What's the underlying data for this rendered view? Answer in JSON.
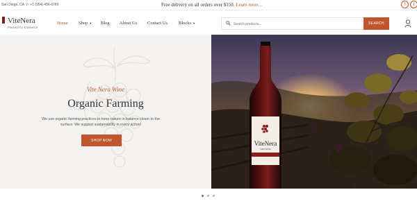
{
  "topbar": {
    "location": "San Diego, CA",
    "phone": "+1 (954) 456-6789",
    "promo_text": "Free delivery on all orders over $150.",
    "promo_link": "Learn more...",
    "social": [
      "facebook-icon",
      "twitter-icon"
    ]
  },
  "brand": {
    "name": "ViteNera",
    "tagline": "Passion for Existence",
    "accent_color": "#c0572c",
    "wine_color": "#7a1a1a"
  },
  "nav": {
    "home": "Home",
    "shop": "Shop",
    "blog": "Blog",
    "about": "About Us",
    "contact": "Contact Us",
    "blocks": "Blocks"
  },
  "search": {
    "placeholder": "Search products...",
    "button": "SEARCH"
  },
  "hero": {
    "script_title": "Vite Nera Wine",
    "title": "Organic Farming",
    "description": "We use organic farming practices to keep nature in balance closer to the surface. We support sustainability in every action!",
    "button": "SHOP NOW"
  },
  "bottle": {
    "brand": "ViteNera",
    "sub": "RED WINE"
  },
  "carousel": {
    "slides": 3,
    "active": 1
  }
}
